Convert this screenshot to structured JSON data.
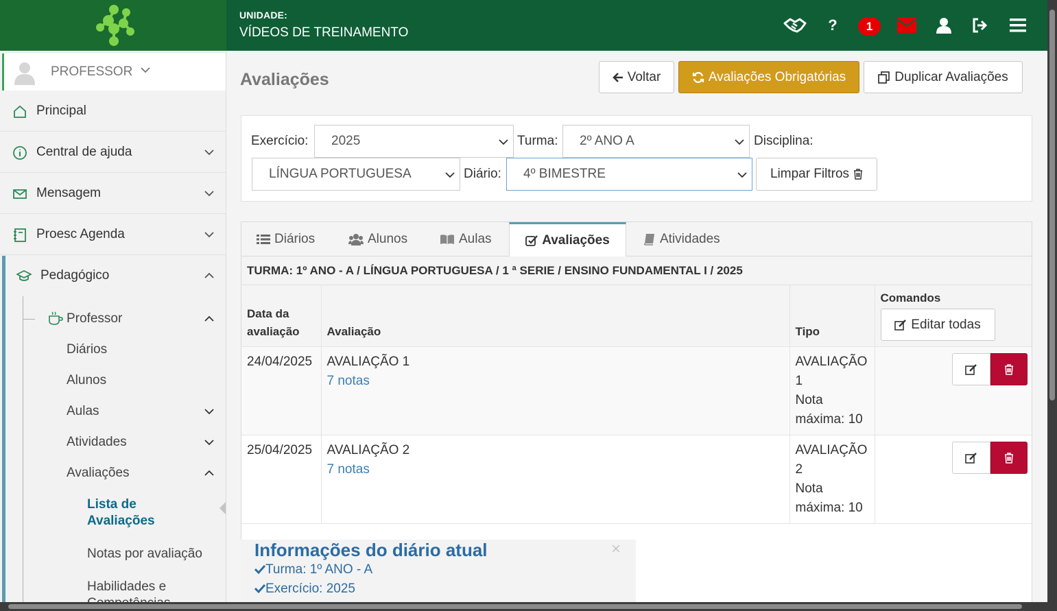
{
  "header": {
    "unit_label": "UNIDADE:",
    "unit_name": "VÍDEOS DE TREINAMENTO",
    "notification_count": "1",
    "icons": [
      "handshake-icon",
      "help-icon",
      "notification-badge",
      "envelope-icon",
      "user-icon",
      "logout-icon",
      "menu-icon"
    ],
    "brand_color": "#0f5e36"
  },
  "sidebar": {
    "profile_name": "PROFESSOR",
    "items": [
      {
        "label": "Principal",
        "icon": "home-icon"
      },
      {
        "label": "Central de ajuda",
        "icon": "info-icon"
      },
      {
        "label": "Mensagem",
        "icon": "envelope-icon"
      },
      {
        "label": "Proesc Agenda",
        "icon": "agenda-icon"
      },
      {
        "label": "Pedagógico",
        "icon": "graduation-cap-icon"
      }
    ],
    "professor_label": "Professor",
    "professor_sub": [
      "Diários",
      "Alunos",
      "Aulas",
      "Atividades",
      "Avaliações"
    ],
    "avaliacoes_sub": {
      "active": "Lista de Avaliações",
      "items": [
        "Notas por avaliação",
        "Habilidades e Competências"
      ]
    }
  },
  "main": {
    "title": "Avaliações",
    "buttons": {
      "back": "Voltar",
      "mandatory": "Avaliações Obrigatórias",
      "duplicate": "Duplicar Avaliações"
    },
    "filters": {
      "exercicio_label": "Exercício:",
      "exercicio_value": "2025",
      "turma_label": "Turma:",
      "turma_value": "2º ANO A",
      "disciplina_label": "Disciplina:",
      "disciplina_value": "LÍNGUA PORTUGUESA",
      "diario_label": "Diário:",
      "diario_value": "4º BIMESTRE",
      "clear_label": "Limpar Filtros"
    },
    "tabs": [
      {
        "label": "Diários",
        "icon": "list-icon"
      },
      {
        "label": "Alunos",
        "icon": "users-icon"
      },
      {
        "label": "Aulas",
        "icon": "book-open-icon"
      },
      {
        "label": "Avaliações",
        "icon": "check-square-icon"
      },
      {
        "label": "Atividades",
        "icon": "book-icon"
      }
    ],
    "turma_line": "TURMA: 1º ANO - A / LÍNGUA PORTUGUESA / 1 ª SERIE / ENSINO FUNDAMENTAL I / 2025",
    "table": {
      "headers": {
        "date_line1": "Data da",
        "date_line2": "avaliação",
        "avaliacao": "Avaliação",
        "tipo": "Tipo",
        "comandos": "Comandos"
      },
      "edit_all": "Editar todas",
      "rows": [
        {
          "date": "24/04/2025",
          "name": "AVALIAÇÃO 1",
          "notes": "7 notas",
          "tipo_l1": "AVALIAÇÃO",
          "tipo_l2": "1",
          "max_l1": "Nota",
          "max_l2": "máxima: 10"
        },
        {
          "date": "25/04/2025",
          "name": "AVALIAÇÃO 2",
          "notes": "7 notas",
          "tipo_l1": "AVALIAÇÃO",
          "tipo_l2": "2",
          "max_l1": "Nota",
          "max_l2": "máxima: 10"
        }
      ]
    },
    "info_box": {
      "title": "Informações do diário atual",
      "close": "×",
      "turma": "Turma: 1º ANO - A",
      "exercicio": "Exercício: 2025"
    }
  }
}
